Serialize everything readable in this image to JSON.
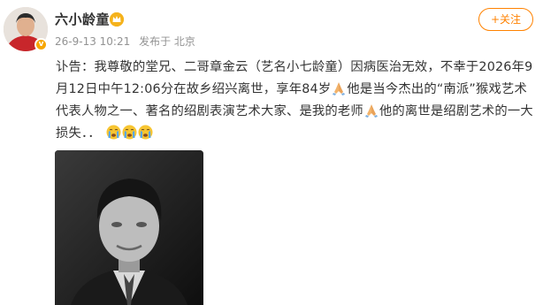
{
  "user": {
    "name": "六小龄童",
    "avatar_icon": "avatar-photo",
    "verified_icon": "verified-badge-icon",
    "vip_icon": "crown-icon"
  },
  "meta": {
    "timestamp": "26-9-13 10:21",
    "source": "发布于 北京"
  },
  "follow_button": {
    "label": "+关注"
  },
  "post": {
    "text_part1": "讣告：我尊敬的堂兄、二哥章金云（艺名小七龄童）因病医治无效，不幸于2026年9月12日中午12:06分在故乡绍兴离世，享年84岁",
    "text_part2": "他是当今杰出的“南派”猴戏艺术代表人物之一、著名的绍剧表演艺术大家、是我的老师",
    "text_part3": "他的离世是绍剧艺术的一大损失．．",
    "emojis": [
      "praying-hands-icon",
      "crying-face-icon"
    ]
  },
  "photo": {
    "description_icon": "portrait-photo"
  },
  "colors": {
    "accent": "#ff8200",
    "meta_gray": "#939393",
    "text": "#333333"
  }
}
